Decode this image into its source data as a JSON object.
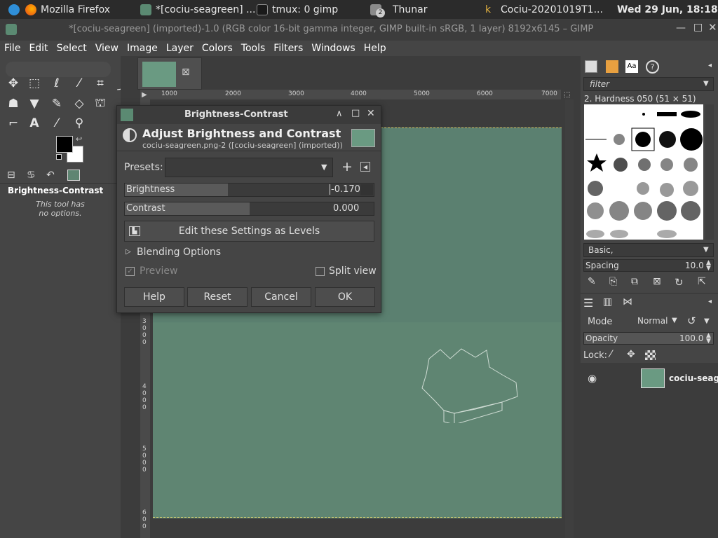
{
  "taskbar": {
    "items": [
      {
        "label": "Mozilla Firefox"
      },
      {
        "label": "*[cociu-seagreen] ..."
      },
      {
        "label": "tmux: 0 gimp"
      },
      {
        "label": "Thunar",
        "badge": "2"
      },
      {
        "label": "Cociu-20201019T1..."
      }
    ],
    "clock": "Wed 29 Jun, 18:18"
  },
  "window": {
    "title": "*[cociu-seagreen] (imported)-1.0 (RGB color 16-bit gamma integer, GIMP built-in sRGB, 1 layer) 8192x6145 – GIMP"
  },
  "menu": [
    "File",
    "Edit",
    "Select",
    "View",
    "Image",
    "Layer",
    "Colors",
    "Tools",
    "Filters",
    "Windows",
    "Help"
  ],
  "tool_options": {
    "title": "Brightness-Contrast",
    "note_line1": "This tool has",
    "note_line2": "no options."
  },
  "ruler": {
    "h_ticks": [
      "1000",
      "2000",
      "3000",
      "4000",
      "5000",
      "6000",
      "7000"
    ],
    "v_ticks": [
      [
        "3",
        "0",
        "0",
        "0"
      ],
      [
        "4",
        "0",
        "0",
        "0"
      ],
      [
        "5",
        "0",
        "0",
        "0"
      ],
      [
        "6",
        "0",
        "0"
      ]
    ]
  },
  "dialog": {
    "title": "Brightness-Contrast",
    "heading": "Adjust Brightness and Contrast",
    "subheading": "cociu-seagreen.png-2 ([cociu-seagreen] (imported))",
    "presets_label": "Presets:",
    "brightness_label": "Brightness",
    "brightness_value": "-0.170",
    "brightness_fraction": 0.415,
    "contrast_label": "Contrast",
    "contrast_value": "0.000",
    "contrast_fraction": 0.5,
    "levels_button": "Edit these Settings as Levels",
    "blending_options": "Blending Options",
    "preview_label": "Preview",
    "split_view_label": "Split view",
    "buttons": {
      "help": "Help",
      "reset": "Reset",
      "cancel": "Cancel",
      "ok": "OK"
    }
  },
  "brushes": {
    "filter_placeholder": "filter",
    "current": "2. Hardness 050 (51 × 51)",
    "tag": "Basic,",
    "spacing_label": "Spacing",
    "spacing_value": "10.0"
  },
  "layers": {
    "mode_label": "Mode",
    "mode_value": "Normal",
    "opacity_label": "Opacity",
    "opacity_value": "100.0",
    "lock_label": "Lock:",
    "layer_name": "cociu-seag"
  },
  "colors": {
    "image_green": "#5f8572",
    "panel_bg": "#454545"
  }
}
